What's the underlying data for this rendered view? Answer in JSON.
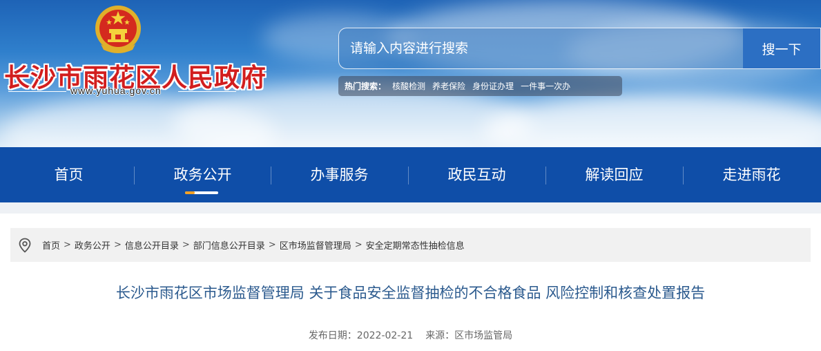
{
  "header": {
    "site_name": "长沙市雨花区人民政府",
    "site_url": "www.yuhua.gov.cn",
    "emblem_icon": "national-emblem-icon"
  },
  "search": {
    "placeholder": "请输入内容进行搜索",
    "button_label": "搜一下",
    "hot_label": "热门搜索：",
    "hot_items": [
      "核酸检测",
      "养老保险",
      "身份证办理",
      "一件事一次办"
    ]
  },
  "nav": {
    "items": [
      "首页",
      "政务公开",
      "办事服务",
      "政民互动",
      "解读回应",
      "走进雨花"
    ],
    "active": "政务公开",
    "background_color": "#0f4ea8"
  },
  "breadcrumb": {
    "icon": "location-pin-icon",
    "items": [
      "首页",
      "政务公开",
      "信息公开目录",
      "部门信息公开目录",
      "区市场监督管理局",
      "安全定期常态性抽检信息"
    ],
    "separator": ">"
  },
  "article": {
    "title": "长沙市雨花区市场监督管理局 关于食品安全监督抽检的不合格食品 风险控制和核查处置报告",
    "date_label": "发布日期：2022-02-21",
    "source_label": "来源：区市场监管局",
    "title_color": "#2b5a8e"
  }
}
